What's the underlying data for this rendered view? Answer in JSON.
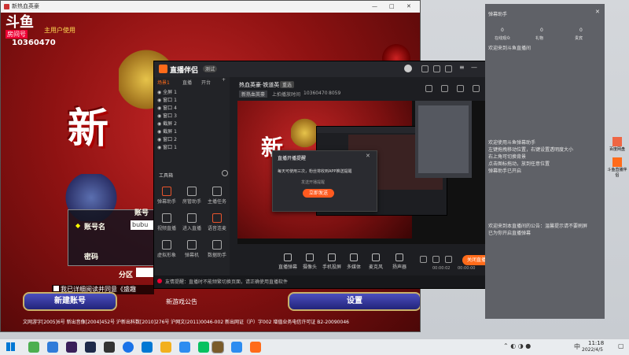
{
  "game": {
    "window_title": "新热血英豪",
    "platform_logo": "斗鱼",
    "room_label": "房间号",
    "room_number": "10360470",
    "user_tag": "主用户使用",
    "account_label": "账号名",
    "account_value": "bubu",
    "password_label": "密码",
    "server_label": "分区",
    "agree_text": "我已详细阅读并同意《盛趣",
    "new_account_button": "新建账号",
    "settings_button": "设置",
    "health_tip": "新游戏公告",
    "footer_text": "文网游字[2005]6号  新出音像[2004]452号  沪新出科数[2010]276号  沪网文(2011)0046-002  新出网证（沪）字002  增值业务电信许可证 B2-20090046"
  },
  "streamer": {
    "app_name": "直播伴侣",
    "version_badge": "测试",
    "tabs": [
      "场景1",
      "直播",
      "开台"
    ],
    "room_title": "热血英豪·铁道英",
    "room_tag": "重选",
    "game_tag": "新热血英豪",
    "stat_label": "上拍播放时间",
    "room_id": "10360470",
    "stat_num": "8059",
    "sources": [
      "全屏 1",
      "窗口 1",
      "窗口 4",
      "窗口 3",
      "截屏 2",
      "截屏 1",
      "窗口 2",
      "窗口 1"
    ],
    "toolbox_label": "工具箱",
    "tools": [
      {
        "label": "弹幕助手",
        "color": "#e8542c"
      },
      {
        "label": "房管助手",
        "color": "#bbbbbb"
      },
      {
        "label": "主播任务",
        "color": "#bbbbbb"
      },
      {
        "label": "视频直播",
        "color": "#bbbbbb"
      },
      {
        "label": "进入直播",
        "color": "#bbbbbb"
      },
      {
        "label": "语音连麦",
        "color": "#e8542c"
      },
      {
        "label": "虚拟形象",
        "color": "#bbbbbb"
      },
      {
        "label": "弹幕机",
        "color": "#bbbbbb"
      },
      {
        "label": "数据助手",
        "color": "#bbbbbb"
      }
    ],
    "dialog_title": "直播开播提醒",
    "dialog_text": "每天可使用三次，粉丝将收到APP推送提醒",
    "dialog_sub": "发送开播提醒",
    "dialog_button": "立即发送",
    "controls": [
      "直播弹幕",
      "摄像头",
      "手机投屏",
      "多媒体",
      "麦克风",
      "扬声器"
    ],
    "timer": "00:00:02",
    "fps": "00:00:00",
    "start_button": "关闭直播",
    "notice": "友情提醒：直播时不能频繁切换页面，请正确使用直播软件"
  },
  "right_panel": {
    "header": "弹幕助手",
    "stats": [
      "0",
      "0",
      "0"
    ],
    "stat_labels": [
      "在线观众",
      "礼物",
      "贵宾"
    ],
    "msg1": "欢迎来到斗鱼直播间",
    "msg2": "欢迎使用斗鱼弹幕助手\n左键拖拽移动位置，右键设置透明度大小\n右上角可切换背景\n点击图标拖动，放到任意位置\n弹幕助手已开启",
    "msg3": "欢迎来到本直播间的公告：温馨提示请不要刷屏\n已为你开启直播弹幕",
    "side_label_1": "百度网盘",
    "side_label_2": "斗鱼直播伴侣"
  },
  "taskbar": {
    "time": "11:18",
    "date": "2022/4/5",
    "ime": "中"
  },
  "colors": {
    "accent": "#ff6b1a",
    "dialog_button": "#ff5a1f",
    "dark": "#1d1e22"
  }
}
